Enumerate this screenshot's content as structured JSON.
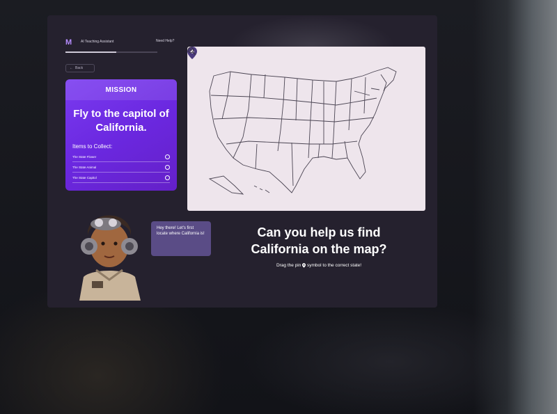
{
  "app": {
    "title": "AI Teaching Assistant",
    "help_link": "Need Help?",
    "progress_fraction": 0.55,
    "back_label": "Back"
  },
  "mission": {
    "header": "MISSION",
    "text": "Fly to the capitol of California.",
    "items_label": "Items to Collect:",
    "items": [
      {
        "label": "The State Flower",
        "icon": "flower-icon"
      },
      {
        "label": "The State Animal",
        "icon": "paw-icon"
      },
      {
        "label": "The State Capitol",
        "icon": "pin-icon"
      }
    ]
  },
  "map": {
    "pin_icon": "map-pin-icon",
    "zoom_icon": "zoom-in-icon"
  },
  "assistant": {
    "speech": "Hey there! Let's first locate where California is!"
  },
  "prompt": {
    "question": "Can you help us find California on the map?",
    "instruction_before": "Drag the pin",
    "instruction_after": "symbol to the correct state!"
  },
  "colors": {
    "mission_purple": "#6b28e0",
    "map_bg": "#eee5ec",
    "speech_bg": "#5a4c86",
    "screen_bg": "#25212e"
  }
}
